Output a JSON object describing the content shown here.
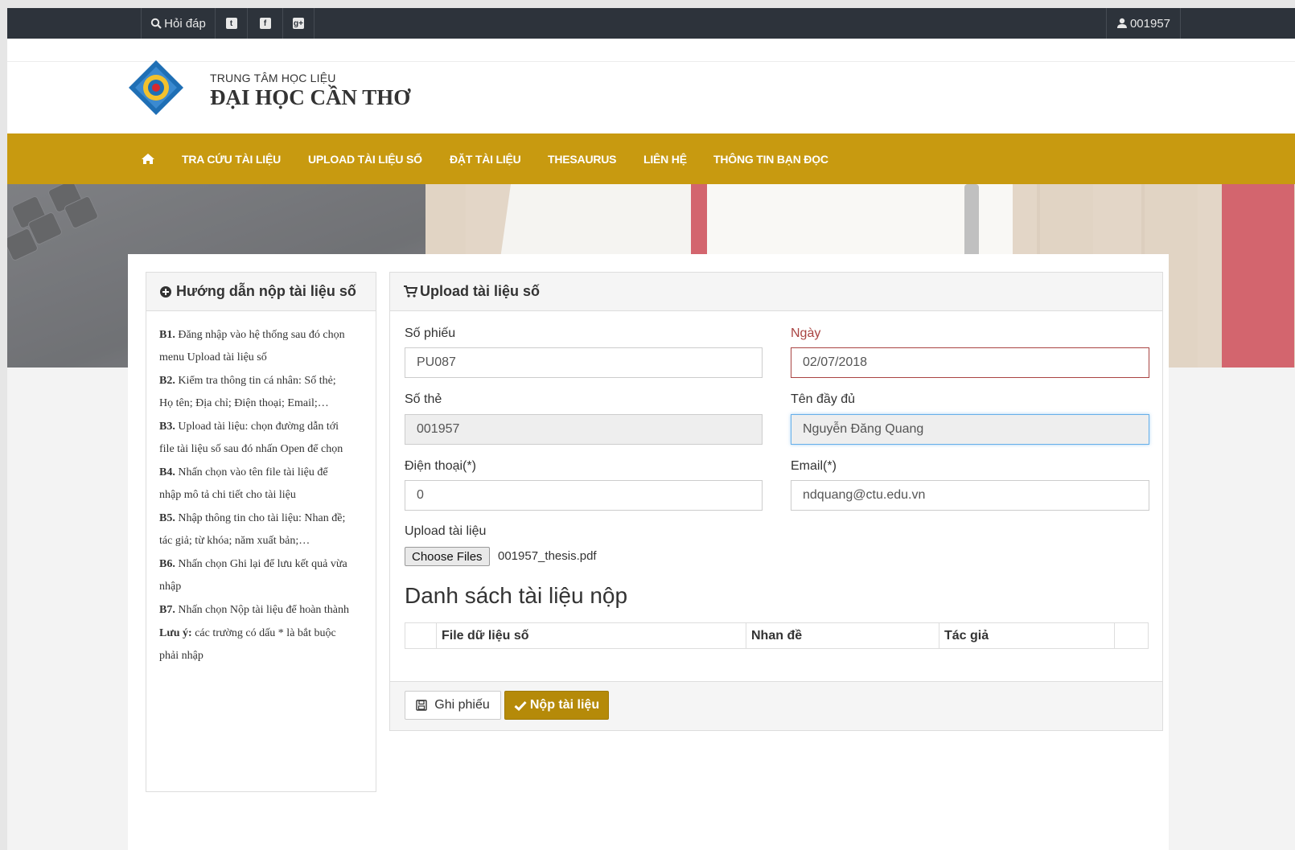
{
  "topbar": {
    "faq_icon": "search-icon",
    "faq_label": "Hỏi đáp",
    "social_icons": [
      "twitter-icon",
      "facebook-icon",
      "google-plus-icon"
    ],
    "user_icon": "user-icon",
    "user_id": "001957"
  },
  "header": {
    "sub": "TRUNG TÂM HỌC LIỆU",
    "main": "ĐẠI HỌC CẦN THƠ"
  },
  "nav": {
    "home_icon": "home-icon",
    "items": [
      "TRA CỨU TÀI LIỆU",
      "UPLOAD TÀI LIỆU SỐ",
      "ĐẶT TÀI LIỆU",
      "THESAURUS",
      "LIÊN HỆ",
      "THÔNG TIN BẠN ĐỌC"
    ]
  },
  "guide": {
    "icon": "plus-circle-icon",
    "title": "Hướng dẫn nộp tài liệu số",
    "steps": [
      {
        "b": "B1.",
        "t": " Đăng nhập vào hệ thống sau đó chọn menu Upload tài liệu số"
      },
      {
        "b": "B2.",
        "t": " Kiểm tra thông tin cá nhân: Số thẻ; Họ tên; Địa chỉ; Điện thoại; Email;…"
      },
      {
        "b": "B3.",
        "t": " Upload tài liệu: chọn đường dẫn tới file tài liệu số sau đó nhấn Open để chọn"
      },
      {
        "b": "B4.",
        "t": " Nhấn chọn vào tên file tài liệu để nhập mô tả chi tiết cho tài liệu"
      },
      {
        "b": "B5.",
        "t": " Nhập thông tin cho tài liệu: Nhan đề; tác giả; từ khóa; năm xuất bản;…"
      },
      {
        "b": "B6.",
        "t": " Nhấn chọn Ghi lại để lưu kết quả vừa nhập"
      },
      {
        "b": "B7.",
        "t": " Nhấn chọn Nộp tài liệu để hoàn thành"
      },
      {
        "b": "Lưu ý:",
        "t": " các trường có dấu * là bắt buộc phải nhập"
      }
    ]
  },
  "upload": {
    "icon": "cart-icon",
    "title": "Upload tài liệu số",
    "fields": {
      "so_phieu": {
        "label": "Số phiếu",
        "value": "PU087"
      },
      "ngay": {
        "label": "Ngày",
        "value": "02/07/2018"
      },
      "so_the": {
        "label": "Số thẻ",
        "value": "001957"
      },
      "ten": {
        "label": "Tên đầy đủ",
        "value": "Nguyễn Đăng Quang"
      },
      "dien_thoai": {
        "label": "Điện thoại(*)",
        "value": "0"
      },
      "email": {
        "label": "Email(*)",
        "value": "ndquang@ctu.edu.vn"
      }
    },
    "file": {
      "label": "Upload tài liệu",
      "button": "Choose Files",
      "name": "001957_thesis.pdf"
    },
    "list_title": "Danh sách tài liệu nộp",
    "table_headers": [
      "",
      "File dữ liệu số",
      "Nhan đề",
      "Tác giả",
      ""
    ],
    "buttons": {
      "save_icon": "floppy-icon",
      "save": "Ghi phiếu",
      "submit_icon": "check-icon",
      "submit": "Nộp tài liệu"
    }
  }
}
